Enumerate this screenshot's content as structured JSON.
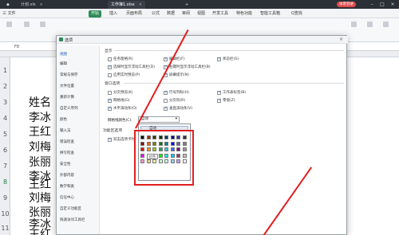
{
  "titlebar": {
    "tabs": [
      {
        "label": "计划.xls"
      },
      {
        "label": "工作簿1.xlsx"
      }
    ],
    "user_badge": "访客登录"
  },
  "menubar": {
    "items": [
      "三 文件",
      "开始",
      "插入",
      "页面布局",
      "公式",
      "数据",
      "审阅",
      "视图",
      "开发工具",
      "特色功能",
      "智能工具箱"
    ],
    "search": "Q查找"
  },
  "formula_bar": {
    "cell_ref": "F8"
  },
  "sheet": {
    "row_numbers": [
      "1",
      "2",
      "3",
      "4",
      "5",
      "6",
      "7",
      "8",
      "9",
      "10",
      "11"
    ],
    "names": [
      "姓名",
      "李冰",
      "王红",
      "刘梅",
      "张丽",
      "李冰",
      "王红",
      "刘梅",
      "张丽",
      "李冰",
      "王红"
    ]
  },
  "dialog": {
    "title": "选项",
    "nav": [
      "视图",
      "编辑",
      "常规与保存",
      "文件位置",
      "重新计算",
      "自定义序列",
      "颜色",
      "输入法",
      "错误检查",
      "拼写检查",
      "安全性",
      "外部内容",
      "数学和类",
      "信任中心",
      "自定义功能区",
      "快速访问工具栏"
    ],
    "sections": {
      "show": "显示",
      "window": "窗口选项",
      "feature": "功能区选项"
    },
    "show_options": [
      {
        "label": "任务窗格(R)",
        "checked": false
      },
      {
        "label": "编辑栏(F)",
        "checked": true
      },
      {
        "label": "状态栏(S)",
        "checked": true
      },
      {
        "label": "选择时显示浮动工具栏(D)",
        "checked": true
      },
      {
        "label": "右键时显示浮动工具栏(B)",
        "checked": true
      },
      {
        "label": "启用实时预览(P)",
        "checked": false
      },
      {
        "label": "屏幕提示(N)",
        "checked": true
      }
    ],
    "window_options": [
      {
        "label": "分页预览(K)",
        "checked": false
      },
      {
        "label": "行号列标(H)",
        "checked": true
      },
      {
        "label": "工作表标签(B)",
        "checked": true
      },
      {
        "label": "网格线(G)",
        "checked": true
      },
      {
        "label": "分页符(R)",
        "checked": false
      },
      {
        "label": "零值(Z)",
        "checked": true
      },
      {
        "label": "水平滚动条(O)",
        "checked": true
      },
      {
        "label": "垂直滚动条(V)",
        "checked": true
      }
    ],
    "grid_color_label": "网格线颜色(C):",
    "grid_color_value": "自动",
    "feature_option": {
      "label": "双击选项卡时",
      "checked": true
    },
    "color_popup": {
      "auto_label": "自动",
      "tooltip": "红色",
      "colors": [
        [
          "#000000",
          "#993300",
          "#333300",
          "#003300",
          "#003366",
          "#000080",
          "#333399",
          "#333333"
        ],
        [
          "#800000",
          "#ff6600",
          "#808000",
          "#008000",
          "#008080",
          "#0000ff",
          "#666699",
          "#808080"
        ],
        [
          "#ff0000",
          "#ff9900",
          "#99cc00",
          "#339966",
          "#33cccc",
          "#3366ff",
          "#800080",
          "#969696"
        ],
        [
          "#ff00ff",
          "#ffcc00",
          "#ffff00",
          "#00ff00",
          "#00ffff",
          "#00ccff",
          "#993366",
          "#c0c0c0"
        ],
        [
          "#ff99cc",
          "#ffcc99",
          "#ffff99",
          "#ccffcc",
          "#ccffff",
          "#99ccff",
          "#cc99ff",
          "#ffffff"
        ]
      ]
    }
  }
}
